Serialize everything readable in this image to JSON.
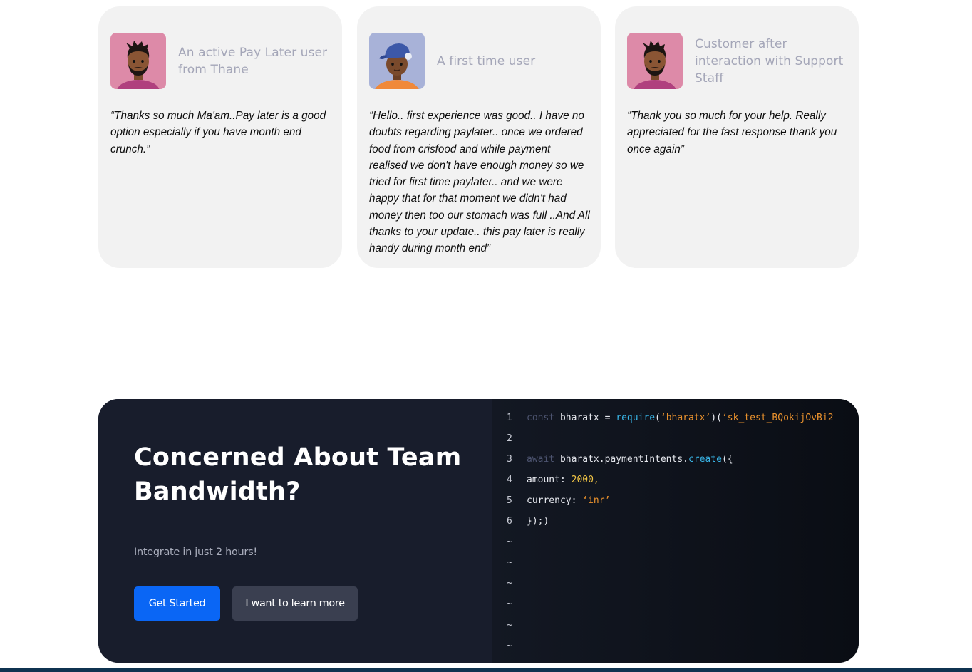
{
  "testimonials": [
    {
      "avatar_icon": "avatar-man-beard-icon",
      "avatar_bg": "#dd8aa8",
      "title": "An active Pay Later user from Thane",
      "quote": "“Thanks so much Ma'am..Pay later is a good option especially if you have month end crunch.”"
    },
    {
      "avatar_icon": "avatar-boy-cap-icon",
      "avatar_bg": "#a8b2d8",
      "title": "A first time user",
      "quote": "“Hello.. first experience was good.. I have no doubts regarding paylater.. once we ordered food from crisfood and while payment realised we don't have enough money so we tried for first time paylater.. and we were happy that for that moment we didn't had money then too our stomach was full ..And All thanks to your update.. this pay later is really handy during month end”"
    },
    {
      "avatar_icon": "avatar-man-beard-icon",
      "avatar_bg": "#dd8aa8",
      "title": "Customer after interaction with Support Staff",
      "quote": "“Thank you so much for your help. Really appreciated for the fast response thank you once again”"
    }
  ],
  "cta": {
    "heading": "Concerned About Team Bandwidth?",
    "subtitle": "Integrate in just 2 hours!",
    "primary_button": "Get Started",
    "secondary_button": "I want to learn more",
    "accent_color": "#0a66f5"
  },
  "code": {
    "lines": [
      {
        "n": "1",
        "tokens": [
          {
            "t": "const ",
            "c": "kw"
          },
          {
            "t": "bharatx = ",
            "c": "plain"
          },
          {
            "t": "require",
            "c": "fn"
          },
          {
            "t": "(",
            "c": "plain"
          },
          {
            "t": "‘bharatx’",
            "c": "str"
          },
          {
            "t": ")(",
            "c": "plain"
          },
          {
            "t": "‘sk_test_BQokijOvBi2",
            "c": "str"
          }
        ]
      },
      {
        "n": "2",
        "tokens": []
      },
      {
        "n": "3",
        "tokens": [
          {
            "t": "await ",
            "c": "kw"
          },
          {
            "t": "bharatx.paymentIntents.",
            "c": "plain"
          },
          {
            "t": "create",
            "c": "fn"
          },
          {
            "t": "({",
            "c": "plain"
          }
        ]
      },
      {
        "n": "4",
        "tokens": [
          {
            "t": "amount: ",
            "c": "plain"
          },
          {
            "t": "2000,",
            "c": "num"
          }
        ]
      },
      {
        "n": "5",
        "tokens": [
          {
            "t": "currency: ",
            "c": "plain"
          },
          {
            "t": "‘inr’",
            "c": "str"
          }
        ]
      },
      {
        "n": "6",
        "tokens": [
          {
            "t": "});)",
            "c": "plain"
          }
        ]
      },
      {
        "n": "~",
        "tokens": []
      },
      {
        "n": "~",
        "tokens": []
      },
      {
        "n": "~",
        "tokens": []
      },
      {
        "n": "~",
        "tokens": []
      },
      {
        "n": "~",
        "tokens": []
      },
      {
        "n": "~",
        "tokens": []
      }
    ]
  }
}
